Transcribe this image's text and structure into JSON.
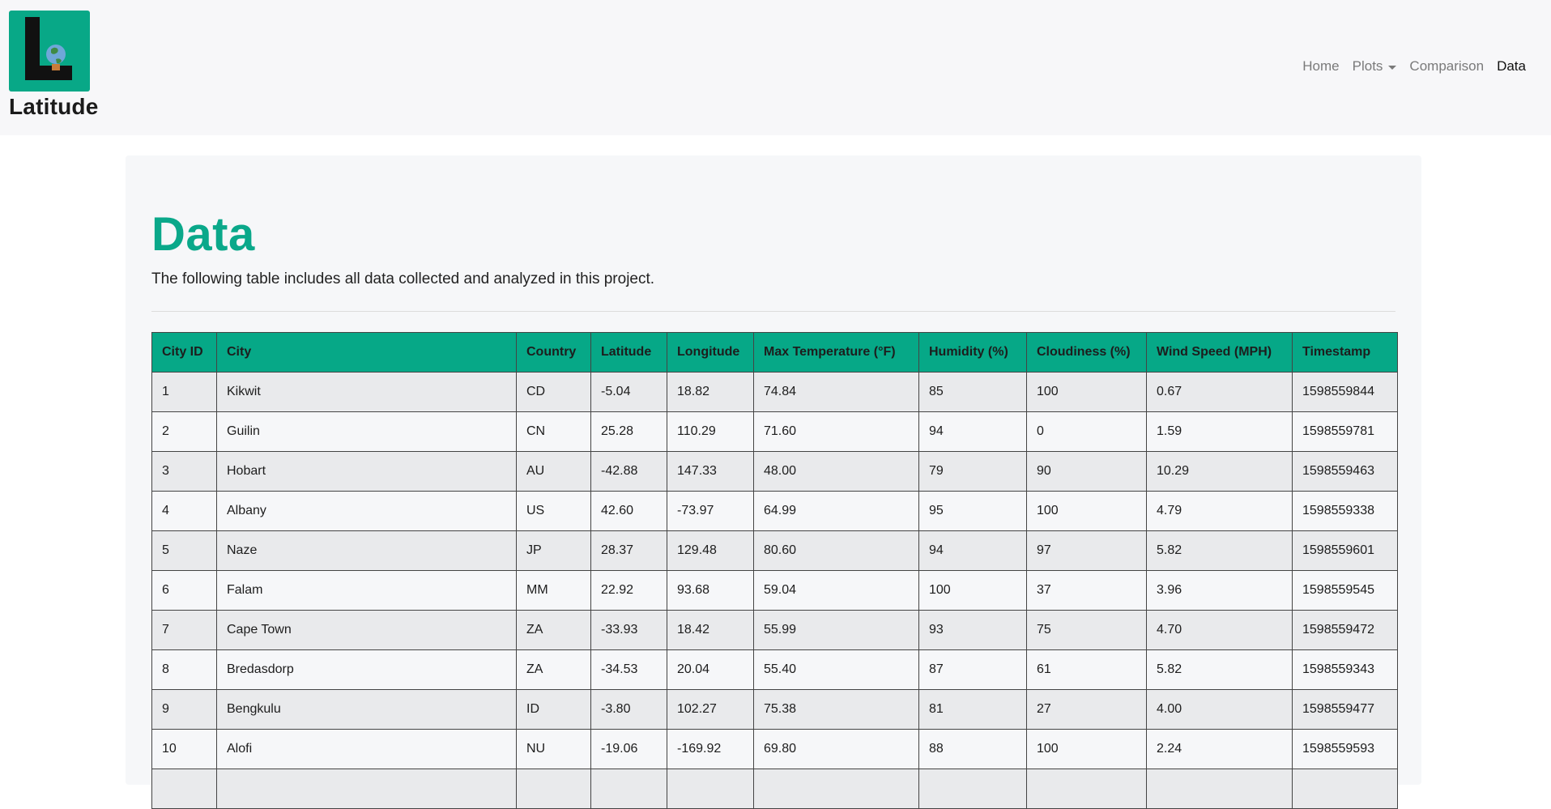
{
  "brand": {
    "name": "Latitude",
    "logo_icon": "globe-l-logo-icon",
    "accent": "#08a887"
  },
  "nav": {
    "items": [
      {
        "label": "Home",
        "active": false
      },
      {
        "label": "Plots",
        "active": false,
        "dropdown": true
      },
      {
        "label": "Comparison",
        "active": false
      },
      {
        "label": "Data",
        "active": true
      }
    ]
  },
  "main": {
    "title": "Data",
    "lead": "The following table includes all data collected and analyzed in this project.",
    "title_color": "#0aa88a"
  },
  "table": {
    "headers": [
      "City ID",
      "City",
      "Country",
      "Latitude",
      "Longitude",
      "Max Temperature (°F)",
      "Humidity (%)",
      "Cloudiness (%)",
      "Wind Speed (MPH)",
      "Timestamp"
    ],
    "rows": [
      [
        "1",
        "Kikwit",
        "CD",
        "-5.04",
        "18.82",
        "74.84",
        "85",
        "100",
        "0.67",
        "1598559844"
      ],
      [
        "2",
        "Guilin",
        "CN",
        "25.28",
        "110.29",
        "71.60",
        "94",
        "0",
        "1.59",
        "1598559781"
      ],
      [
        "3",
        "Hobart",
        "AU",
        "-42.88",
        "147.33",
        "48.00",
        "79",
        "90",
        "10.29",
        "1598559463"
      ],
      [
        "4",
        "Albany",
        "US",
        "42.60",
        "-73.97",
        "64.99",
        "95",
        "100",
        "4.79",
        "1598559338"
      ],
      [
        "5",
        "Naze",
        "JP",
        "28.37",
        "129.48",
        "80.60",
        "94",
        "97",
        "5.82",
        "1598559601"
      ],
      [
        "6",
        "Falam",
        "MM",
        "22.92",
        "93.68",
        "59.04",
        "100",
        "37",
        "3.96",
        "1598559545"
      ],
      [
        "7",
        "Cape Town",
        "ZA",
        "-33.93",
        "18.42",
        "55.99",
        "93",
        "75",
        "4.70",
        "1598559472"
      ],
      [
        "8",
        "Bredasdorp",
        "ZA",
        "-34.53",
        "20.04",
        "55.40",
        "87",
        "61",
        "5.82",
        "1598559343"
      ],
      [
        "9",
        "Bengkulu",
        "ID",
        "-3.80",
        "102.27",
        "75.38",
        "81",
        "27",
        "4.00",
        "1598559477"
      ],
      [
        "10",
        "Alofi",
        "NU",
        "-19.06",
        "-169.92",
        "69.80",
        "88",
        "100",
        "2.24",
        "1598559593"
      ],
      [
        "",
        "",
        "",
        "",
        "",
        "",
        "",
        "",
        "",
        ""
      ]
    ]
  }
}
